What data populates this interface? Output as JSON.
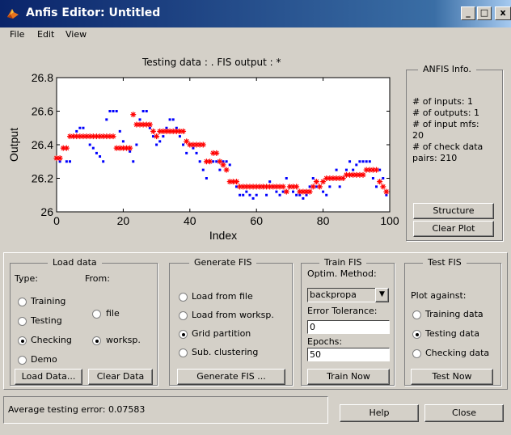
{
  "window": {
    "title": "Anfis Editor: Untitled",
    "controls": {
      "minimize": "_",
      "maximize": "□",
      "close": "x"
    }
  },
  "menu": [
    "File",
    "Edit",
    "View"
  ],
  "plot": {
    "header": "Testing data : .   FIS output : *",
    "ylabel": "Output",
    "xlabel": "Index",
    "yticks": [
      "26.8",
      "26.6",
      "26.4",
      "26.2",
      "26"
    ],
    "xticks": [
      "0",
      "20",
      "40",
      "60",
      "80",
      "100"
    ],
    "xlim": [
      0,
      100
    ],
    "ylim": [
      26,
      26.8
    ],
    "series_colors": {
      "testing_data": "#0000ff",
      "fis_output": "#ff0000"
    }
  },
  "chart_data": {
    "type": "scatter",
    "title": "Testing data : .   FIS output : *",
    "xlabel": "Index",
    "ylabel": "Output",
    "xlim": [
      0,
      100
    ],
    "ylim": [
      26,
      26.8
    ],
    "series": [
      {
        "name": "Testing data",
        "marker": ".",
        "color": "#0000ff",
        "x": [
          0,
          1,
          2,
          3,
          4,
          5,
          6,
          7,
          8,
          9,
          10,
          11,
          12,
          13,
          14,
          15,
          16,
          17,
          18,
          19,
          20,
          21,
          22,
          23,
          24,
          25,
          26,
          27,
          28,
          29,
          30,
          31,
          32,
          33,
          34,
          35,
          36,
          37,
          38,
          39,
          40,
          41,
          42,
          43,
          44,
          45,
          46,
          47,
          48,
          49,
          50,
          51,
          52,
          53,
          54,
          55,
          56,
          57,
          58,
          59,
          60,
          61,
          62,
          63,
          64,
          65,
          66,
          67,
          68,
          69,
          70,
          71,
          72,
          73,
          74,
          75,
          76,
          77,
          78,
          79,
          80,
          81,
          82,
          83,
          84,
          85,
          86,
          87,
          88,
          89,
          90,
          91,
          92,
          93,
          94,
          95,
          96,
          97,
          98,
          99
        ],
        "y": [
          26.32,
          26.3,
          26.38,
          26.3,
          26.3,
          26.45,
          26.48,
          26.5,
          26.5,
          26.45,
          26.4,
          26.38,
          26.35,
          26.33,
          26.3,
          26.55,
          26.6,
          26.6,
          26.6,
          26.48,
          26.42,
          26.38,
          26.36,
          26.3,
          26.4,
          26.55,
          26.6,
          26.6,
          26.5,
          26.45,
          26.4,
          26.42,
          26.45,
          26.5,
          26.55,
          26.55,
          26.5,
          26.45,
          26.4,
          26.35,
          26.4,
          26.38,
          26.35,
          26.3,
          26.25,
          26.2,
          26.3,
          26.3,
          26.3,
          26.25,
          26.3,
          26.3,
          26.28,
          26.18,
          26.15,
          26.1,
          26.1,
          26.12,
          26.1,
          26.08,
          26.1,
          26.15,
          26.15,
          26.1,
          26.18,
          26.15,
          26.12,
          26.1,
          26.12,
          26.2,
          26.15,
          26.12,
          26.1,
          26.1,
          26.08,
          26.1,
          26.15,
          26.2,
          26.15,
          26.15,
          26.12,
          26.1,
          26.15,
          26.2,
          26.25,
          26.15,
          26.2,
          26.25,
          26.3,
          26.25,
          26.28,
          26.3,
          26.3,
          26.3,
          26.3,
          26.2,
          26.15,
          26.25,
          26.2,
          26.1
        ]
      },
      {
        "name": "FIS output",
        "marker": "*",
        "color": "#ff0000",
        "x": [
          0,
          1,
          2,
          3,
          4,
          5,
          6,
          7,
          8,
          9,
          10,
          11,
          12,
          13,
          14,
          15,
          16,
          17,
          18,
          19,
          20,
          21,
          22,
          23,
          24,
          25,
          26,
          27,
          28,
          29,
          30,
          31,
          32,
          33,
          34,
          35,
          36,
          37,
          38,
          39,
          40,
          41,
          42,
          43,
          44,
          45,
          46,
          47,
          48,
          49,
          50,
          51,
          52,
          53,
          54,
          55,
          56,
          57,
          58,
          59,
          60,
          61,
          62,
          63,
          64,
          65,
          66,
          67,
          68,
          69,
          70,
          71,
          72,
          73,
          74,
          75,
          76,
          77,
          78,
          79,
          80,
          81,
          82,
          83,
          84,
          85,
          86,
          87,
          88,
          89,
          90,
          91,
          92,
          93,
          94,
          95,
          96,
          97,
          98,
          99
        ],
        "y": [
          26.32,
          26.32,
          26.38,
          26.38,
          26.45,
          26.45,
          26.45,
          26.45,
          26.45,
          26.45,
          26.45,
          26.45,
          26.45,
          26.45,
          26.45,
          26.45,
          26.45,
          26.45,
          26.38,
          26.38,
          26.38,
          26.38,
          26.38,
          26.58,
          26.52,
          26.52,
          26.52,
          26.52,
          26.52,
          26.48,
          26.45,
          26.48,
          26.48,
          26.48,
          26.48,
          26.48,
          26.48,
          26.48,
          26.48,
          26.42,
          26.4,
          26.4,
          26.4,
          26.4,
          26.4,
          26.3,
          26.3,
          26.35,
          26.35,
          26.3,
          26.28,
          26.25,
          26.18,
          26.18,
          26.18,
          26.15,
          26.15,
          26.15,
          26.15,
          26.15,
          26.15,
          26.15,
          26.15,
          26.15,
          26.15,
          26.15,
          26.15,
          26.15,
          26.15,
          26.12,
          26.15,
          26.15,
          26.15,
          26.12,
          26.12,
          26.12,
          26.12,
          26.15,
          26.18,
          26.15,
          26.18,
          26.2,
          26.2,
          26.2,
          26.2,
          26.2,
          26.2,
          26.22,
          26.22,
          26.22,
          26.22,
          26.22,
          26.22,
          26.25,
          26.25,
          26.25,
          26.25,
          26.18,
          26.15,
          26.12
        ]
      }
    ]
  },
  "anfis_info": {
    "title": "ANFIS Info.",
    "lines": [
      "# of inputs: 1",
      "# of outputs: 1",
      "# of input mfs:",
      "20",
      "# of check data",
      "pairs: 210"
    ],
    "structure_button": "Structure",
    "clear_plot_button": "Clear Plot"
  },
  "load_data": {
    "title": "Load data",
    "type_label": "Type:",
    "from_label": "From:",
    "types": [
      {
        "label": "Training",
        "selected": false
      },
      {
        "label": "Testing",
        "selected": false
      },
      {
        "label": "Checking",
        "selected": true
      },
      {
        "label": "Demo",
        "selected": false
      }
    ],
    "sources": [
      {
        "label": "file",
        "selected": false
      },
      {
        "label": "worksp.",
        "selected": true
      }
    ],
    "load_button": "Load Data...",
    "clear_button": "Clear Data"
  },
  "generate_fis": {
    "title": "Generate FIS",
    "options": [
      {
        "label": "Load from file",
        "selected": false
      },
      {
        "label": "Load from worksp.",
        "selected": false
      },
      {
        "label": "Grid partition",
        "selected": true
      },
      {
        "label": "Sub. clustering",
        "selected": false
      }
    ],
    "button": "Generate FIS ..."
  },
  "train_fis": {
    "title": "Train FIS",
    "optim_label": "Optim. Method:",
    "method": "backpropa",
    "error_label": "Error Tolerance:",
    "error_value": "0",
    "epochs_label": "Epochs:",
    "epochs_value": "50",
    "button": "Train Now"
  },
  "test_fis": {
    "title": "Test FIS",
    "plot_against": "Plot against:",
    "options": [
      {
        "label": "Training data",
        "selected": false
      },
      {
        "label": "Testing data",
        "selected": true
      },
      {
        "label": "Checking data",
        "selected": false
      }
    ],
    "button": "Test Now"
  },
  "status": {
    "text": "Average testing error: 0.07583"
  },
  "footer": {
    "help": "Help",
    "close": "Close"
  }
}
